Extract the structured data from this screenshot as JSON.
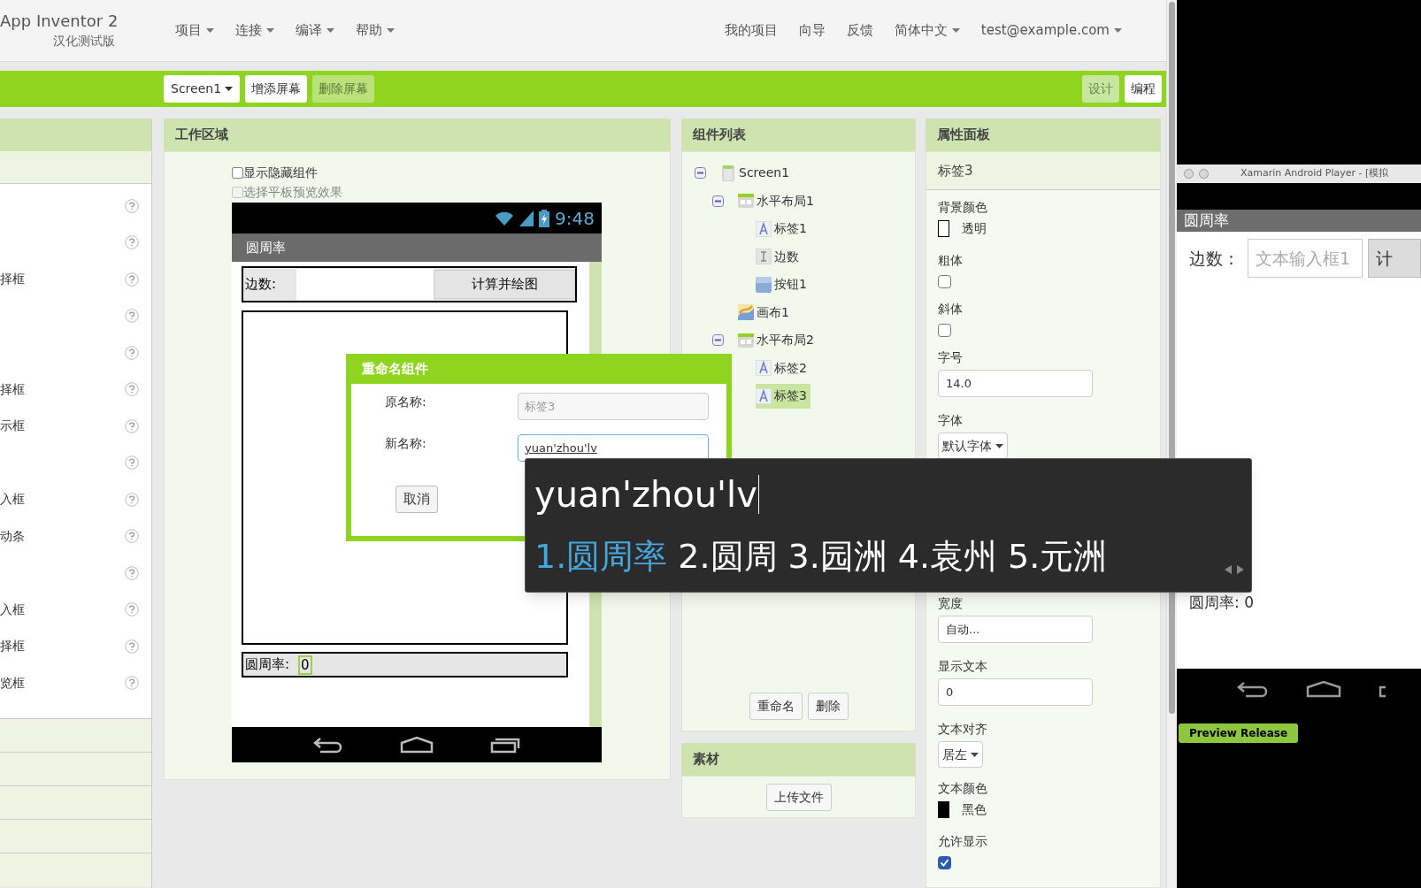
{
  "header": {
    "title": "App Inventor 2",
    "subtitle": "汉化测试版",
    "menus": [
      {
        "label": "项目",
        "dropdown": true
      },
      {
        "label": "连接",
        "dropdown": true
      },
      {
        "label": "编译",
        "dropdown": true
      },
      {
        "label": "帮助",
        "dropdown": true
      }
    ],
    "links": [
      {
        "label": "我的项目",
        "dropdown": false
      },
      {
        "label": "向导",
        "dropdown": false
      },
      {
        "label": "反馈",
        "dropdown": false
      },
      {
        "label": "简体中文",
        "dropdown": true
      },
      {
        "label": "test@example.com",
        "dropdown": true
      }
    ]
  },
  "toolbar": {
    "screen_select": "Screen1",
    "buttons": [
      {
        "label": "增添屏幕",
        "disabled": false
      },
      {
        "label": "删除屏幕",
        "disabled": true
      }
    ],
    "view_tabs": [
      {
        "label": "设计",
        "selected": true
      },
      {
        "label": "编程",
        "selected": false
      }
    ]
  },
  "palette": {
    "items": [
      {
        "help_icon": true
      },
      {
        "help_icon": true
      },
      {
        "label": "择框",
        "help_icon": true
      },
      {
        "help_icon": true
      },
      {
        "help_icon": true
      },
      {
        "label": "择框",
        "help_icon": true
      },
      {
        "label": "示框",
        "help_icon": true
      },
      {
        "help_icon": true
      },
      {
        "label": "入框",
        "help_icon": true
      },
      {
        "label": "动条",
        "help_icon": true
      },
      {
        "help_icon": true
      },
      {
        "label": "入框",
        "help_icon": true
      },
      {
        "label": "择框",
        "help_icon": true
      },
      {
        "label": "览框",
        "help_icon": true
      }
    ]
  },
  "workspace": {
    "title": "工作区域",
    "options": [
      {
        "label": "显示隐藏组件",
        "checked": false,
        "disabled": false
      },
      {
        "label": "选择平板预览效果",
        "checked": false,
        "disabled": true
      }
    ],
    "phone": {
      "time": "9:48",
      "app_title": "圆周率",
      "row1_label": "边数:",
      "row1_button": "计算并绘图",
      "row2_label": "圆周率:",
      "row2_value": "0"
    }
  },
  "rename_dialog": {
    "title": "重命名组件",
    "fields": [
      {
        "label": "原名称:",
        "value": "标签3",
        "disabled": true
      },
      {
        "label": "新名称:",
        "value": "yuan'zhou'lv",
        "disabled": false
      }
    ],
    "cancel": "取消"
  },
  "ime": {
    "composition": "yuan'zhou'lv",
    "candidates": [
      {
        "label": "1.圆周率",
        "selected": true
      },
      {
        "label": "2.圆周",
        "selected": false
      },
      {
        "label": "3.园洲",
        "selected": false
      },
      {
        "label": "4.袁州",
        "selected": false
      },
      {
        "label": "5.元洲",
        "selected": false
      }
    ]
  },
  "components": {
    "title": "组件列表",
    "tree": [
      {
        "label": "Screen1",
        "kind": "screen",
        "expanded": true,
        "selected": false,
        "children": [
          {
            "label": "水平布局1",
            "kind": "arrangement",
            "expanded": true,
            "selected": false,
            "children": [
              {
                "label": "标签1",
                "kind": "label",
                "selected": false
              },
              {
                "label": "边数",
                "kind": "textbox",
                "selected": false
              },
              {
                "label": "按钮1",
                "kind": "button",
                "selected": false
              }
            ]
          },
          {
            "label": "画布1",
            "kind": "canvas",
            "selected": false
          },
          {
            "label": "水平布局2",
            "kind": "arrangement",
            "expanded": true,
            "selected": false,
            "children": [
              {
                "label": "标签2",
                "kind": "label",
                "selected": false
              },
              {
                "label": "标签3",
                "kind": "label",
                "selected": true
              }
            ]
          }
        ]
      }
    ],
    "buttons": [
      "重命名",
      "删除"
    ]
  },
  "media": {
    "title": "素材",
    "button": "上传文件"
  },
  "properties": {
    "title": "属性面板",
    "component": "标签3",
    "items": [
      {
        "kind": "color",
        "label": "背景颜色",
        "value": "透明",
        "color": "#ffffff"
      },
      {
        "kind": "checkbox",
        "label": "粗体",
        "checked": false
      },
      {
        "kind": "checkbox",
        "label": "斜体",
        "checked": false
      },
      {
        "kind": "text",
        "label": "字号",
        "value": "14.0"
      },
      {
        "kind": "dropdown",
        "label": "字体",
        "value": "默认字体"
      },
      {
        "kind": "text",
        "label": "宽度",
        "value": "自动..."
      },
      {
        "kind": "text",
        "label": "显示文本",
        "value": "0"
      },
      {
        "kind": "dropdown",
        "label": "文本对齐",
        "value": "居左"
      },
      {
        "kind": "color",
        "label": "文本颜色",
        "value": "黑色",
        "color": "#000000"
      },
      {
        "kind": "checkbox",
        "label": "允许显示",
        "checked": true
      }
    ]
  },
  "emulator": {
    "window_title": "Xamarin Android Player - [模拟",
    "app_title": "圆周率",
    "label": "边数：",
    "field_placeholder": "文本输入框1",
    "button": "计",
    "result": "圆周率: 0",
    "badge": "Preview Release"
  }
}
